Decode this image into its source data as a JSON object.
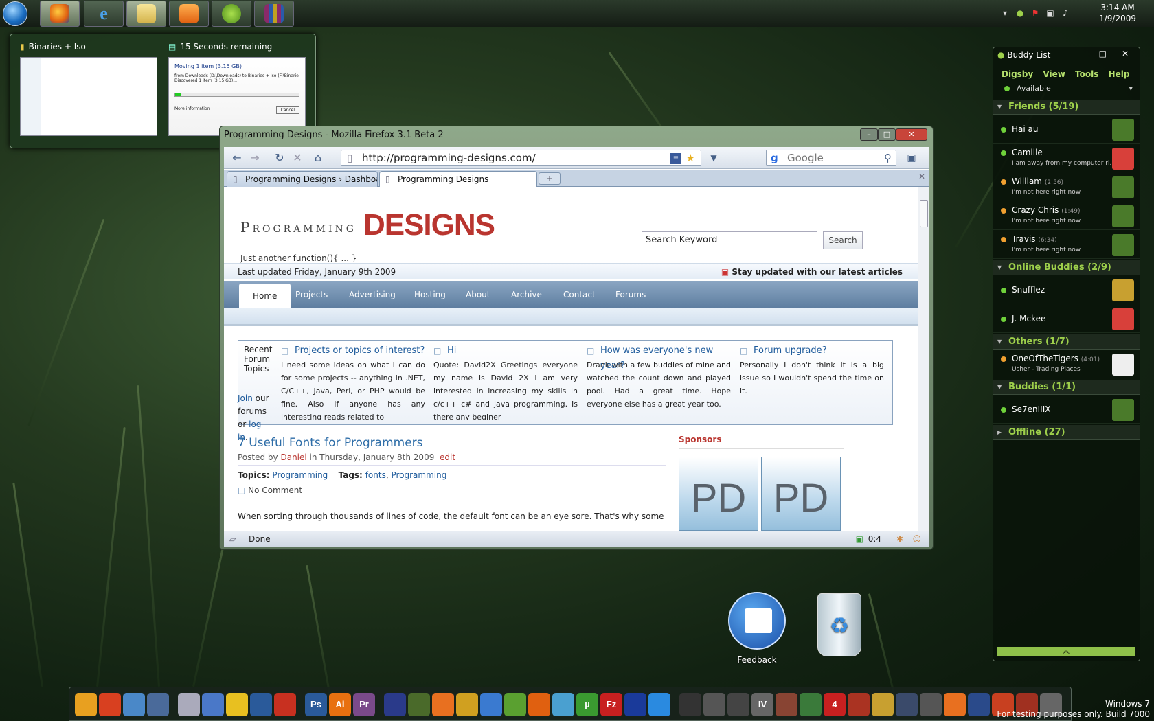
{
  "colors": {
    "accent_green": "#9ed04b",
    "site_red": "#b9352f",
    "link_blue": "#1d5a9b",
    "nav_blue": "#6e8db0"
  },
  "taskbar": {
    "start_icon": "windows-orb-icon",
    "pinned": [
      "firefox-icon",
      "internet-explorer-icon",
      "explorer-icon",
      "media-player-icon",
      "digsby-icon",
      "winrar-icon"
    ],
    "clock_time": "3:14 AM",
    "clock_date": "1/9/2009"
  },
  "previews": [
    {
      "title": "Binaries + Iso",
      "icon": "folder-icon"
    },
    {
      "title": "15 Seconds remaining",
      "icon": "copy-icon",
      "dialog_header": "Moving 1 item (3.15 GB)",
      "dialog_line1": "from Downloads (D:\\Downloads) to Binaries + Iso (F:\\Binaries + Is",
      "dialog_line2": "Discovered 1 item (3.15 GB)...",
      "more_info": "More information",
      "cancel": "Cancel",
      "progress": 0.05
    }
  ],
  "firefox": {
    "title": "Programming Designs - Mozilla Firefox 3.1 Beta 2",
    "url": "http://programming-designs.com/",
    "search_placeholder": "Google",
    "tabs": [
      "Programming Designs › Dashboard...",
      "Programming Designs"
    ],
    "status": "Done",
    "status_count": "0:4"
  },
  "site": {
    "title_small": "Programming",
    "title_big": "DESIGNS",
    "tagline": "Just another function(){ ... }",
    "search_value": "Search Keyword",
    "search_button": "Search",
    "last_updated": "Last updated Friday, January 9th 2009",
    "rss_text": "Stay updated with our latest articles",
    "nav": [
      "Home",
      "Projects",
      "Advertising",
      "Hosting",
      "About",
      "Archive",
      "Contact",
      "Forums"
    ],
    "forum_label": "Recent Forum Topics",
    "join_text": "Join",
    "join_mid": "our forums or",
    "login_text": "log in",
    "forum_topics": [
      {
        "title": "Projects or topics of interest?",
        "body": "I need some ideas on what I can do for some projects -- anything in .NET, C/C++, Java, Perl, or PHP would be fine. Also if anyone has any interesting reads related to"
      },
      {
        "title": "Hi",
        "body": "Quote: David2X Greetings everyone my name is David 2X I am very interested in increasing my skills in c/c++ c# and java programming. Is there any beginer"
      },
      {
        "title": "How was everyone's new year?",
        "body": "Drank with a few buddies of mine and watched the count down and played pool. Had a great time. Hope everyone else has a great year too."
      },
      {
        "title": "Forum upgrade?",
        "body": "Personally I don't think it is a big issue so I wouldn't spend the time on it."
      }
    ],
    "post": {
      "title": "7 Useful Fonts for Programmers",
      "posted_by": "Posted by",
      "author": "Daniel",
      "date": "in Thursday, January 8th 2009",
      "edit": "edit",
      "topics_label": "Topics:",
      "topic": "Programming",
      "tags_label": "Tags:",
      "tags": [
        "fonts",
        "Programming"
      ],
      "comment": "No Comment",
      "excerpt": "When sorting through thousands of lines of code, the default font can be an eye sore. That's why some people made"
    },
    "sponsors_title": "Sponsors",
    "sponsor_logo": "PD"
  },
  "buddy_list": {
    "title": "Buddy List",
    "menu": [
      "Digsby",
      "View",
      "Tools",
      "Help"
    ],
    "status": "Available",
    "groups": [
      {
        "label": "Friends (5/19)",
        "buddies": [
          {
            "name": "Hai au",
            "idle": "",
            "status": "",
            "dot": "#6fd13a",
            "avatar": "#4a7a2a"
          },
          {
            "name": "Camille",
            "idle": "",
            "status": "I am away from my computer ri...",
            "dot": "#6fd13a",
            "avatar": "#d8403a"
          },
          {
            "name": "William",
            "idle": "(2:56)",
            "status": "I'm not here right now",
            "dot": "#f0a030",
            "avatar": "#4a7a2a"
          },
          {
            "name": "Crazy Chris",
            "idle": "(1:49)",
            "status": "I'm not here right now",
            "dot": "#f0a030",
            "avatar": "#4a7a2a"
          },
          {
            "name": "Travis",
            "idle": "(6:34)",
            "status": "I'm not here right now",
            "dot": "#f0a030",
            "avatar": "#4a7a2a"
          }
        ]
      },
      {
        "label": "Online Buddies (2/9)",
        "buddies": [
          {
            "name": "Snufflez",
            "idle": "",
            "status": "",
            "dot": "#6fd13a",
            "avatar": "#c8a030"
          },
          {
            "name": "J. Mckee",
            "idle": "",
            "status": "",
            "dot": "#6fd13a",
            "avatar": "#d8403a"
          }
        ]
      },
      {
        "label": "Others (1/7)",
        "buddies": [
          {
            "name": "OneOfTheTigers",
            "idle": "(4:01)",
            "status": "Usher - Trading Places",
            "dot": "#f0a030",
            "avatar": "#eeeeee"
          }
        ]
      },
      {
        "label": "Buddies (1/1)",
        "buddies": [
          {
            "name": "Se7enIIIX",
            "idle": "",
            "status": "",
            "dot": "#6fd13a",
            "avatar": "#4a7a2a"
          }
        ]
      },
      {
        "label": "Offline (27)",
        "buddies": []
      }
    ]
  },
  "desktop": {
    "feedback_label": "Feedback",
    "recycle_icon": "recycle-bin-icon"
  },
  "dock": {
    "app_labels": [
      "Ps",
      "Ai",
      "Pr",
      "µ",
      "Fz",
      "IV",
      "4"
    ],
    "windows_text": "Windows 7",
    "build_text": "For testing purposes only. Build 7000"
  }
}
